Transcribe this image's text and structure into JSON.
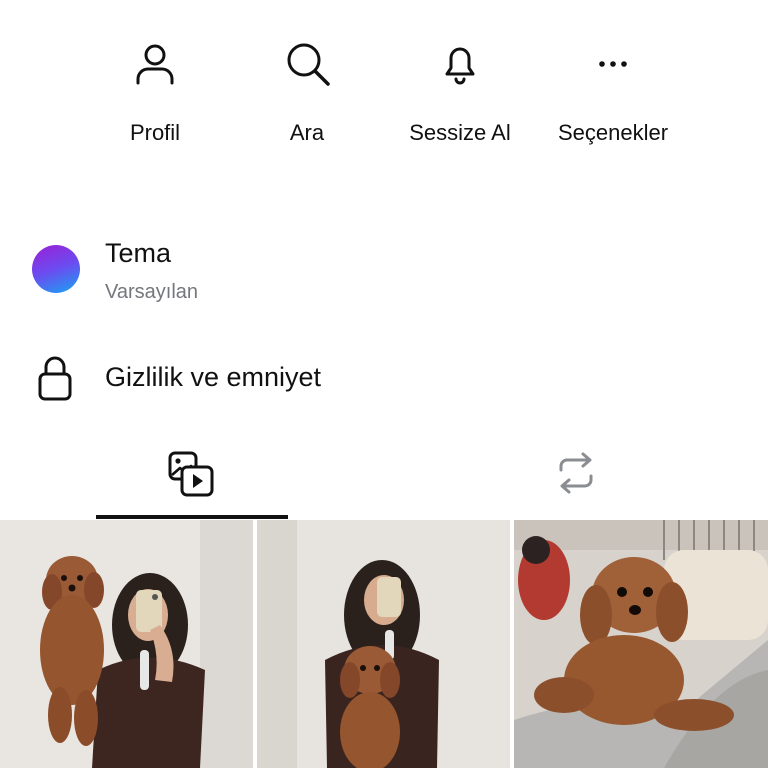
{
  "actions": [
    {
      "label": "Profil",
      "icon": "person-icon"
    },
    {
      "label": "Ara",
      "icon": "search-icon"
    },
    {
      "label": "Sessize Al",
      "icon": "bell-icon"
    },
    {
      "label": "Seçenekler",
      "icon": "more-dots-icon"
    }
  ],
  "settings": {
    "theme": {
      "title": "Tema",
      "value": "Varsayılan",
      "gradient": [
        "#9b1fd6",
        "#6b4cf0",
        "#17a5f2"
      ]
    },
    "privacy": {
      "title": "Gizlilik ve emniyet",
      "icon": "lock-icon"
    }
  },
  "tabs": [
    {
      "icon": "media-icon",
      "active": true
    },
    {
      "icon": "repost-icon",
      "active": false
    }
  ],
  "media_grid": [
    {
      "description": "woman-mirror-selfie-holding-brown-puppy-up"
    },
    {
      "description": "woman-mirror-selfie-holding-puppy-at-waist"
    },
    {
      "description": "brown-poodle-puppy-on-grey-blanket"
    }
  ],
  "colors": {
    "text": "#111111",
    "muted": "#74777c",
    "inactive_icon": "#8a8d91",
    "background": "#ffffff"
  }
}
